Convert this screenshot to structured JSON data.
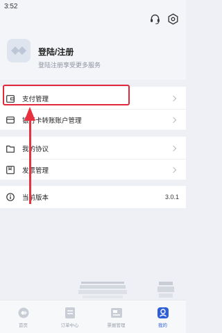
{
  "status_bar": {
    "time": "3:52"
  },
  "top_icons": [
    "headset-icon",
    "settings-icon"
  ],
  "profile": {
    "title": "登陆/注册",
    "subtitle": "登陆注册享受更多服务"
  },
  "menu": {
    "payment": {
      "label": "支付管理",
      "icon": "wallet-icon"
    },
    "bank_transfer": {
      "label": "银行卡转账账户管理",
      "icon": "card-icon"
    },
    "agreement": {
      "label": "我的协议",
      "icon": "folder-icon"
    },
    "invoice": {
      "label": "发票管理",
      "icon": "bookmark-icon"
    },
    "version": {
      "label": "当前版本",
      "value": "3.0.1",
      "icon": "info-icon"
    }
  },
  "tabs": [
    {
      "label": "首页",
      "icon": "home-icon",
      "active": false
    },
    {
      "label": "订单中心",
      "icon": "orders-icon",
      "active": false
    },
    {
      "label": "票据管理",
      "icon": "bills-icon",
      "active": false
    },
    {
      "label": "我的",
      "icon": "profile-icon",
      "active": true
    }
  ],
  "colors": {
    "accent": "#2f5fd8",
    "annotation": "#e0283a",
    "background": "#eef0f5"
  }
}
